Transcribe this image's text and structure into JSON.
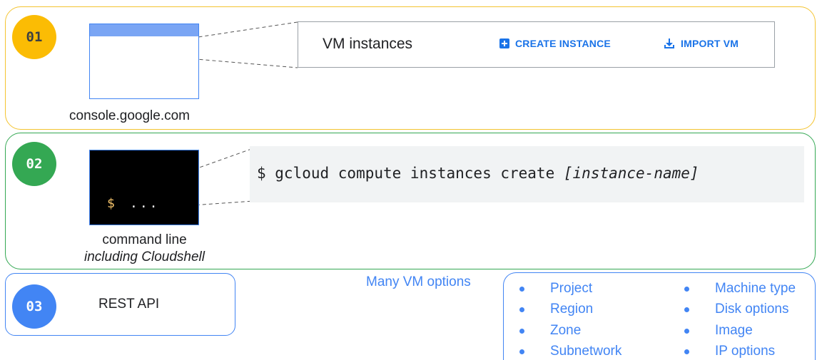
{
  "panels": {
    "console": {
      "badge": "01",
      "label": "console.google.com",
      "vm_bar": {
        "title": "VM instances",
        "create_label": "CREATE INSTANCE",
        "import_label": "IMPORT VM"
      }
    },
    "command_line": {
      "badge": "02",
      "label_line1": "command line",
      "label_line2": "including Cloudshell",
      "terminal_prompt": "$",
      "terminal_cmd": "...",
      "command": "$ gcloud compute instances create",
      "command_arg": "[instance-name]"
    },
    "rest": {
      "badge": "03",
      "label": "REST API"
    }
  },
  "options": {
    "title": "Many VM options",
    "left_column": [
      "Project",
      "Region",
      "Zone",
      "Subnetwork"
    ],
    "right_column": [
      "Machine type",
      "Disk options",
      "Image",
      "IP options"
    ]
  },
  "colors": {
    "console": "#fbbc04",
    "command_line": "#34a853",
    "rest": "#4285f4",
    "link": "#1a73e8"
  }
}
